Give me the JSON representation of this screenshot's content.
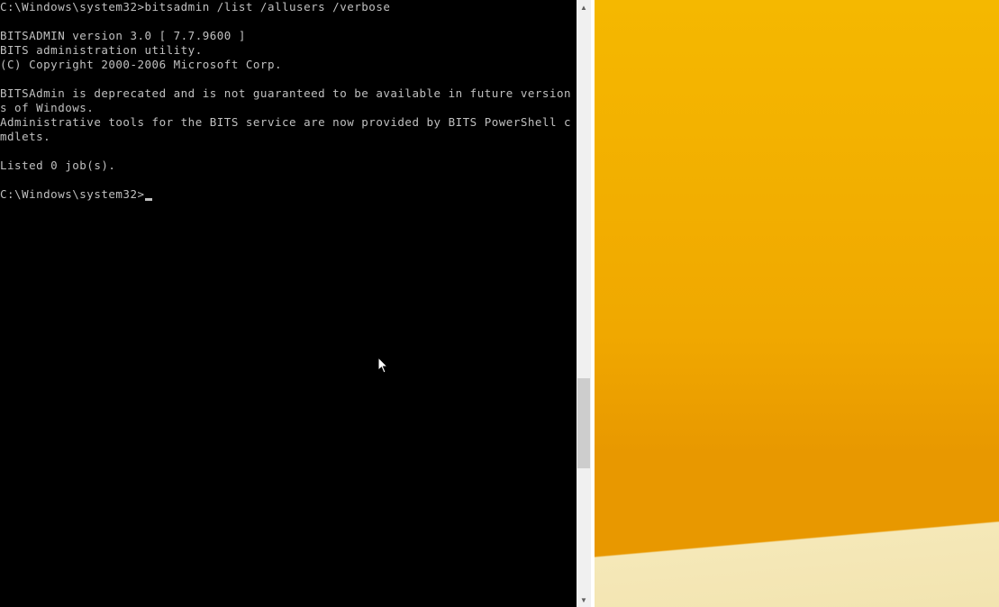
{
  "console": {
    "prompt_top": "C:\\Windows\\system32>",
    "command": "bitsadmin /list /allusers /verbose",
    "output_lines": [
      "",
      "BITSADMIN version 3.0 [ 7.7.9600 ]",
      "BITS administration utility.",
      "(C) Copyright 2000-2006 Microsoft Corp.",
      "",
      "BITSAdmin is deprecated and is not guaranteed to be available in future versions of Windows.",
      "Administrative tools for the BITS service are now provided by BITS PowerShell cmdlets.",
      "",
      "Listed 0 job(s).",
      ""
    ],
    "prompt_bottom": "C:\\Windows\\system32>"
  },
  "scrollbar": {
    "up": "▲",
    "down": "▼"
  }
}
